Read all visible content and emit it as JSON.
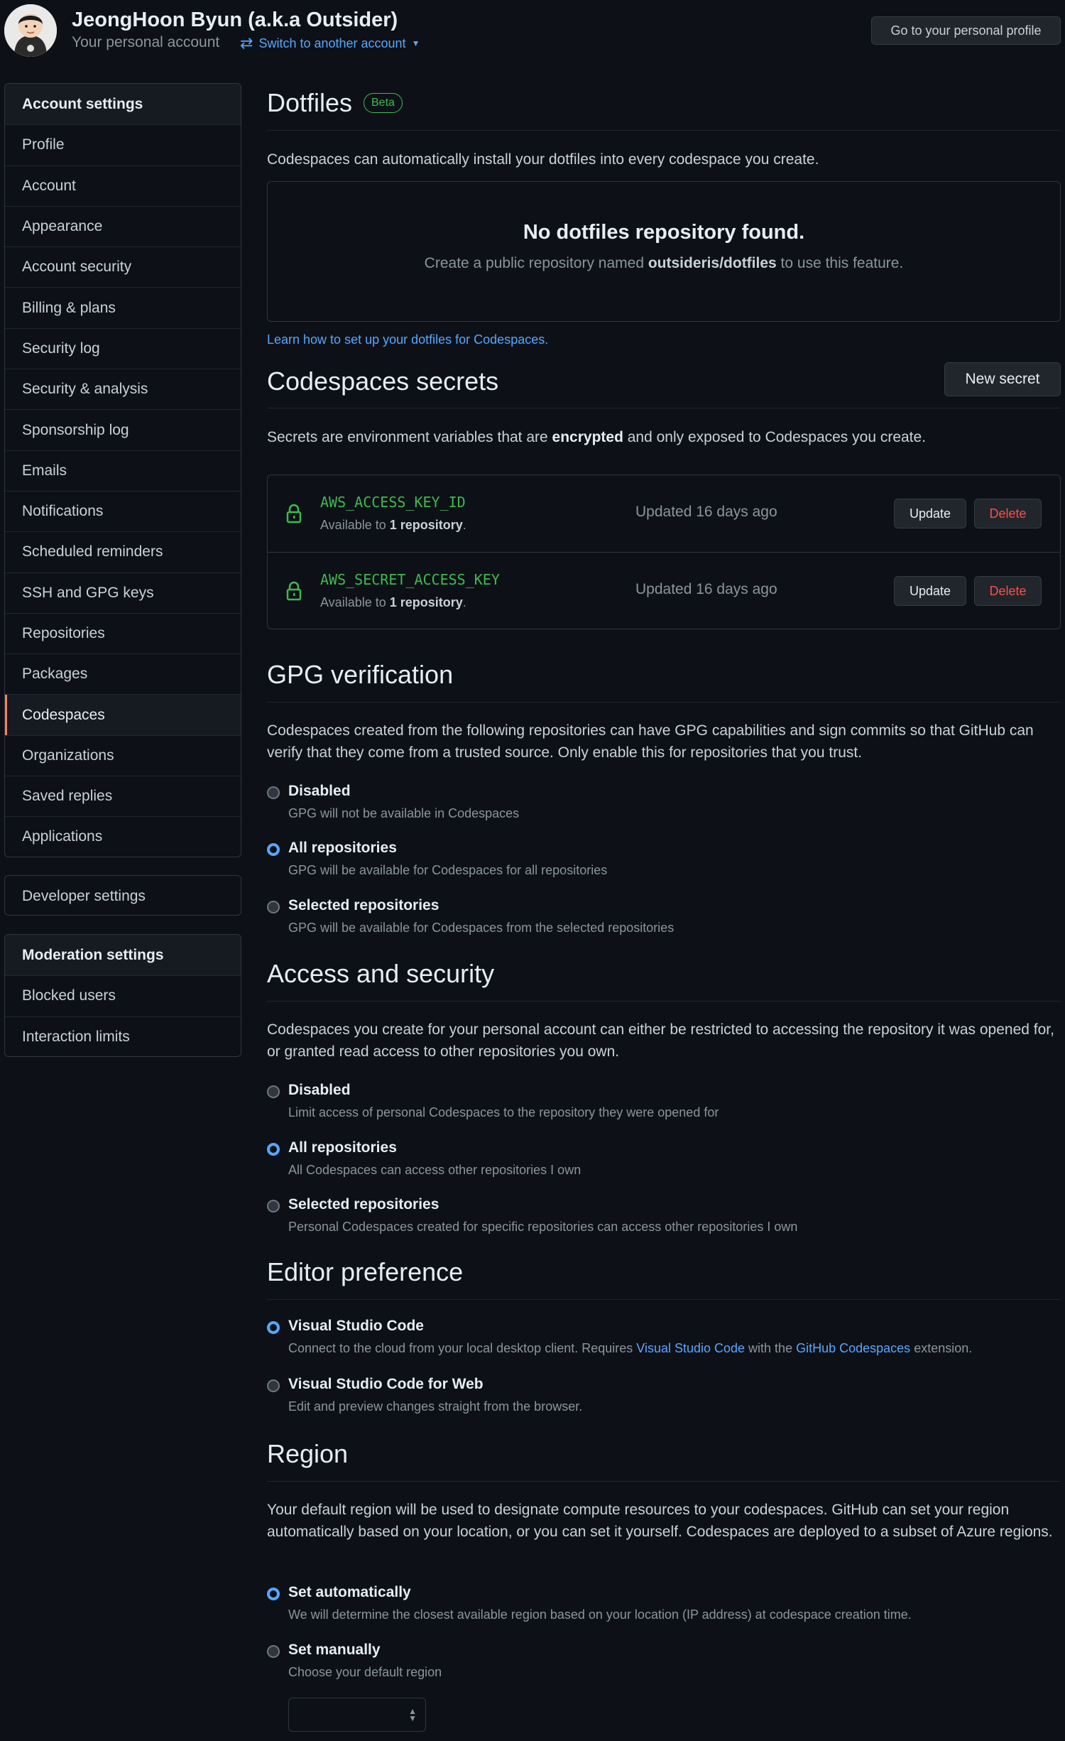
{
  "header": {
    "user_name": "JeongHoon Byun (a.k.a Outsider)",
    "account_type": "Your personal account",
    "switch_label": "Switch to another account",
    "profile_button": "Go to your personal profile"
  },
  "sidebar": {
    "account_group": [
      {
        "label": "Account settings",
        "heading": true
      },
      {
        "label": "Profile"
      },
      {
        "label": "Account"
      },
      {
        "label": "Appearance"
      },
      {
        "label": "Account security"
      },
      {
        "label": "Billing & plans"
      },
      {
        "label": "Security log"
      },
      {
        "label": "Security & analysis"
      },
      {
        "label": "Sponsorship log"
      },
      {
        "label": "Emails"
      },
      {
        "label": "Notifications"
      },
      {
        "label": "Scheduled reminders"
      },
      {
        "label": "SSH and GPG keys"
      },
      {
        "label": "Repositories"
      },
      {
        "label": "Packages"
      },
      {
        "label": "Codespaces",
        "active": true
      },
      {
        "label": "Organizations"
      },
      {
        "label": "Saved replies"
      },
      {
        "label": "Applications"
      }
    ],
    "developer_settings": "Developer settings",
    "moderation_group": [
      {
        "label": "Moderation settings",
        "heading": true
      },
      {
        "label": "Blocked users"
      },
      {
        "label": "Interaction limits"
      }
    ]
  },
  "dotfiles": {
    "title": "Dotfiles",
    "badge": "Beta",
    "description": "Codespaces can automatically install your dotfiles into every codespace you create.",
    "blank_title": "No dotfiles repository found.",
    "blank_pre": "Create a public repository named ",
    "blank_repo": "outsideris/dotfiles",
    "blank_post": " to use this feature.",
    "learn_link": "Learn how to set up your dotfiles for Codespaces."
  },
  "secrets": {
    "title": "Codespaces secrets",
    "new_button": "New secret",
    "desc_pre": "Secrets are environment variables that are ",
    "desc_bold": "encrypted",
    "desc_post": " and only exposed to Codespaces you create.",
    "items": [
      {
        "name": "AWS_ACCESS_KEY_ID",
        "avail_pre": "Available to ",
        "avail_bold": "1 repository",
        "avail_post": ".",
        "updated": "Updated 16 days ago",
        "update": "Update",
        "delete": "Delete"
      },
      {
        "name": "AWS_SECRET_ACCESS_KEY",
        "avail_pre": "Available to ",
        "avail_bold": "1 repository",
        "avail_post": ".",
        "updated": "Updated 16 days ago",
        "update": "Update",
        "delete": "Delete"
      }
    ]
  },
  "gpg": {
    "title": "GPG verification",
    "description": "Codespaces created from the following repositories can have GPG capabilities and sign commits so that GitHub can verify that they come from a trusted source. Only enable this for repositories that you trust.",
    "options": [
      {
        "label": "Disabled",
        "note": "GPG will not be available in Codespaces",
        "checked": false
      },
      {
        "label": "All repositories",
        "note": "GPG will be available for Codespaces for all repositories",
        "checked": true
      },
      {
        "label": "Selected repositories",
        "note": "GPG will be available for Codespaces from the selected repositories",
        "checked": false
      }
    ]
  },
  "access": {
    "title": "Access and security",
    "description": "Codespaces you create for your personal account can either be restricted to accessing the repository it was opened for, or granted read access to other repositories you own.",
    "options": [
      {
        "label": "Disabled",
        "note": "Limit access of personal Codespaces to the repository they were opened for",
        "checked": false
      },
      {
        "label": "All repositories",
        "note": "All Codespaces can access other repositories I own",
        "checked": true
      },
      {
        "label": "Selected repositories",
        "note": "Personal Codespaces created for specific repositories can access other repositories I own",
        "checked": false
      }
    ]
  },
  "editor": {
    "title": "Editor preference",
    "vscode_label": "Visual Studio Code",
    "vscode_note_1": "Connect to the cloud from your local desktop client. Requires ",
    "vscode_link": "Visual Studio Code",
    "vscode_note_2": " with the ",
    "codespaces_link": "GitHub Codespaces",
    "vscode_note_3": " extension.",
    "web_label": "Visual Studio Code for Web",
    "web_note": "Edit and preview changes straight from the browser."
  },
  "region": {
    "title": "Region",
    "description": "Your default region will be used to designate compute resources to your codespaces. GitHub can set your region automatically based on your location, or you can set it yourself. Codespaces are deployed to a subset of Azure regions.",
    "options": [
      {
        "label": "Set automatically",
        "note": "We will determine the closest available region based on your location (IP address) at codespace creation time.",
        "checked": true
      },
      {
        "label": "Set manually",
        "note": "Choose your default region",
        "checked": false
      }
    ],
    "select_value": ""
  }
}
